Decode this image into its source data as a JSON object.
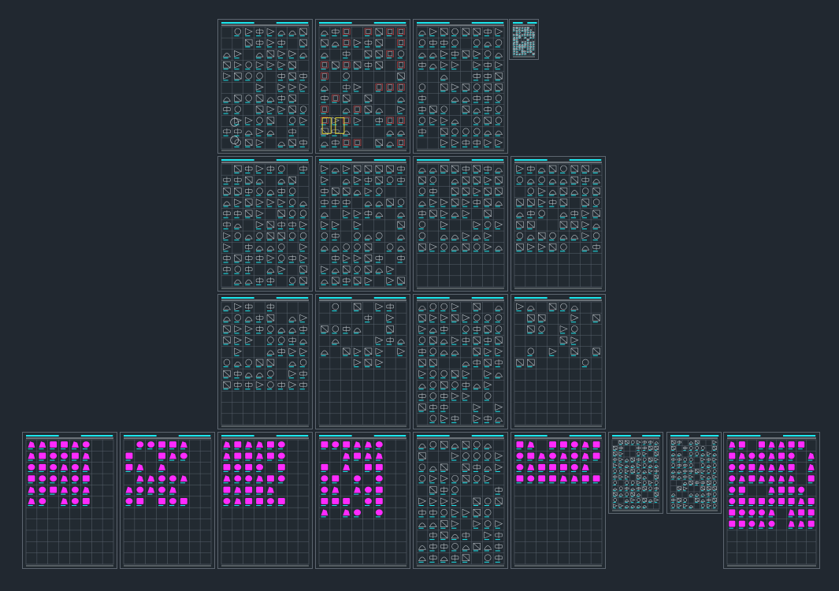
{
  "canvas": {
    "background": "#212830",
    "frame_color": "#5d6670",
    "grid_color": "#58626c",
    "header_color": "#1de9f0",
    "title_color": "#e6edf0",
    "block_colors": {
      "symbol": "#b7bec4",
      "door": "#e04444",
      "column": "#f2e034",
      "fixture": "#ff2aff"
    }
  },
  "sheets": [
    {
      "id": "s01",
      "style": "mixed"
    },
    {
      "id": "s02",
      "style": "doors"
    },
    {
      "id": "s03",
      "style": "appliances"
    },
    {
      "id": "s04",
      "style": "index"
    },
    {
      "id": "s05",
      "style": "dense"
    },
    {
      "id": "s06",
      "style": "dense"
    },
    {
      "id": "s07",
      "style": "furniture"
    },
    {
      "id": "s08",
      "style": "furniture"
    },
    {
      "id": "s09",
      "style": "tables"
    },
    {
      "id": "s10",
      "style": "sparse"
    },
    {
      "id": "s11",
      "style": "appliances"
    },
    {
      "id": "s12",
      "style": "sparse"
    },
    {
      "id": "s13",
      "style": "magenta"
    },
    {
      "id": "s14",
      "style": "magenta"
    },
    {
      "id": "s15",
      "style": "magenta"
    },
    {
      "id": "s16",
      "style": "magenta-dense"
    },
    {
      "id": "s17",
      "style": "fixtures"
    },
    {
      "id": "s18",
      "style": "magenta-strip"
    },
    {
      "id": "s19",
      "style": "grid-small"
    },
    {
      "id": "s20",
      "style": "grid-small"
    },
    {
      "id": "s21",
      "style": "magenta-full"
    }
  ]
}
